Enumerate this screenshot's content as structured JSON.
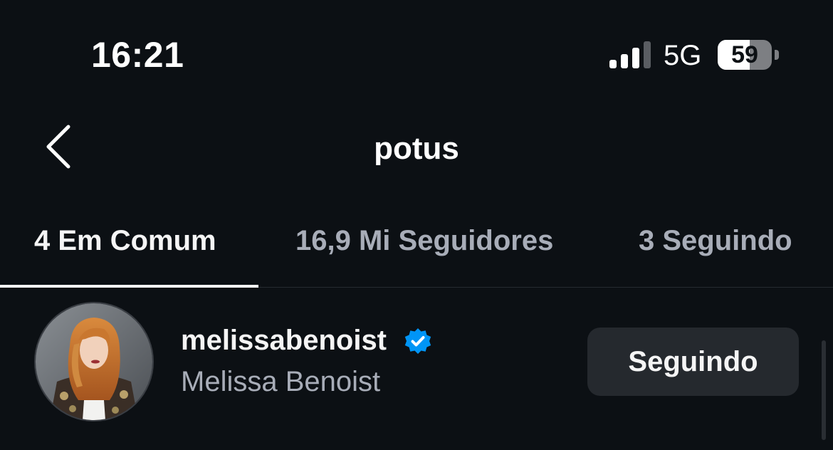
{
  "status_bar": {
    "time": "16:21",
    "network": "5G",
    "battery_percent": "59",
    "battery_level": 0.59,
    "signal_bars_active": 3,
    "signal_bars_total": 4
  },
  "header": {
    "title": "potus",
    "back_icon": "chevron-left-icon"
  },
  "tabs": [
    {
      "label": "4 Em Comum",
      "active": true
    },
    {
      "label": "16,9 Mi Seguidores",
      "active": false
    },
    {
      "label": "3 Seguindo",
      "active": false
    }
  ],
  "list": [
    {
      "username": "melissabenoist",
      "full_name": "Melissa Benoist",
      "verified": true,
      "button_label": "Seguindo"
    }
  ],
  "colors": {
    "background": "#0c1014",
    "text_primary": "#f5f5f5",
    "text_secondary": "#a8adb8",
    "button_bg": "#25292e",
    "verified_blue": "#0095f6"
  }
}
